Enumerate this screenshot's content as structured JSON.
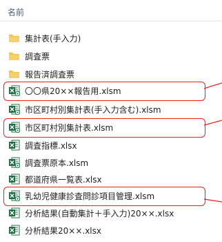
{
  "column_header": "名前",
  "files": [
    {
      "name": "集計表(手入力)",
      "type": "folder"
    },
    {
      "name": "調査票",
      "type": "folder"
    },
    {
      "name": "報告済調査票",
      "type": "folder"
    },
    {
      "name": "〇〇県20××報告用.xlsm",
      "type": "xlsm",
      "highlighted": true
    },
    {
      "name": "市区町村別集計表(手入力含む).xlsm",
      "type": "xlsm"
    },
    {
      "name": "市区町村別集計表.xlsm",
      "type": "xlsm",
      "highlighted": true
    },
    {
      "name": "調査指標.xlsx",
      "type": "xlsx"
    },
    {
      "name": "調査票原本.xlsm",
      "type": "xlsm"
    },
    {
      "name": "都道府県一覧表.xlsx",
      "type": "xlsx"
    },
    {
      "name": "乳幼児健康診査問診項目管理.xlsm",
      "type": "xlsm",
      "highlighted": true
    },
    {
      "name": "分析結果(自動集計＋手入力)20××.xlsx",
      "type": "xlsx"
    },
    {
      "name": "分析結果20××.xlsx",
      "type": "xlsx"
    }
  ],
  "colors": {
    "folder": "#f5c34a",
    "excel": "#1d7044",
    "highlight": "#e2231a"
  }
}
